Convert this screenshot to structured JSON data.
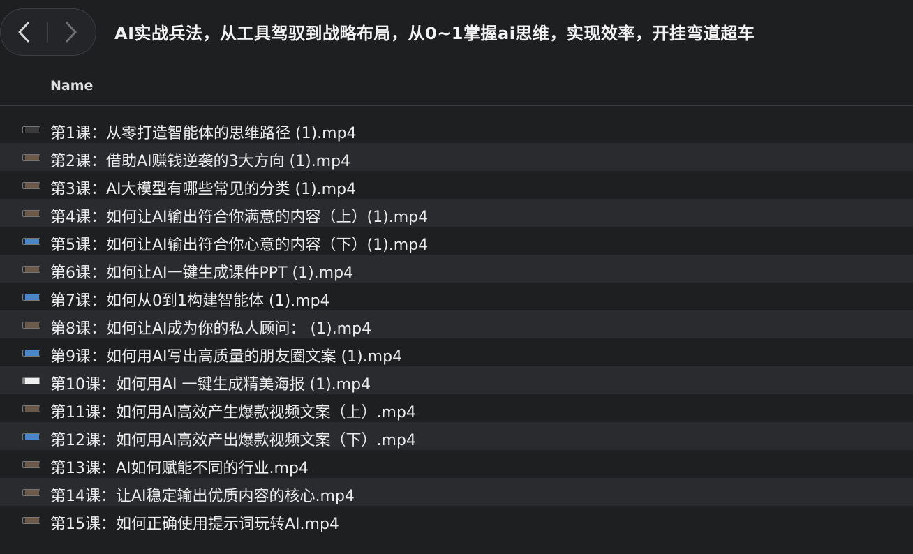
{
  "window": {
    "title": "AI实战兵法，从工具驾驭到战略布局，从0~1掌握ai思维，实现效率，开挂弯道超车"
  },
  "toolbar": {
    "back_icon": "chevron-left-icon",
    "forward_icon": "chevron-right-icon"
  },
  "columns": {
    "name": "Name"
  },
  "files": [
    {
      "name": "第1课：从零打造智能体的思维路径 (1).mp4",
      "thumb": "dark"
    },
    {
      "name": "第2课：借助AI赚钱逆袭的3大方向 (1).mp4",
      "thumb": "brown"
    },
    {
      "name": "第3课：AI大模型有哪些常见的分类 (1).mp4",
      "thumb": "brown"
    },
    {
      "name": "第4课：如何让AI输出符合你满意的内容（上）(1).mp4",
      "thumb": "brown"
    },
    {
      "name": "第5课：如何让AI输出符合你心意的内容（下）(1).mp4",
      "thumb": "blue"
    },
    {
      "name": "第6课：如何让AI一键生成课件PPT (1).mp4",
      "thumb": "brown"
    },
    {
      "name": "第7课：如何从0到1构建智能体 (1).mp4",
      "thumb": "blue"
    },
    {
      "name": "第8课：如何让AI成为你的私人顾问： (1).mp4",
      "thumb": "brown"
    },
    {
      "name": "第9课：如何用AI写出高质量的朋友圈文案 (1).mp4",
      "thumb": "blue"
    },
    {
      "name": "第10课：如何用AI 一键生成精美海报 (1).mp4",
      "thumb": "white"
    },
    {
      "name": "第11课：如何用AI高效产生爆款视频文案（上）.mp4",
      "thumb": "brown"
    },
    {
      "name": "第12课：如何用AI高效产出爆款视频文案（下）.mp4",
      "thumb": "blue"
    },
    {
      "name": "第13课：AI如何赋能不同的行业.mp4",
      "thumb": "brown"
    },
    {
      "name": "第14课：让AI稳定输出优质内容的核心.mp4",
      "thumb": "brown"
    },
    {
      "name": "第15课：如何正确使用提示词玩转AI.mp4",
      "thumb": "brown"
    }
  ]
}
